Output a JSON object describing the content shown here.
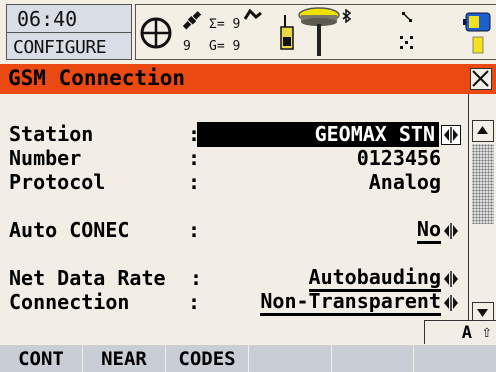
{
  "status": {
    "time": "06:40",
    "app_name": "CONFIGURE",
    "sat_sigma": "Σ= 9",
    "sat_g": "G= 9",
    "sat_count": "9"
  },
  "panel": {
    "title": "GSM Connection"
  },
  "fields": [
    {
      "label": "Station",
      "value": "GEOMAX STN"
    },
    {
      "label": "Number",
      "value": "0123456"
    },
    {
      "label": "Protocol",
      "value": "Analog"
    },
    {
      "label": "Auto CONEC",
      "value": "No"
    },
    {
      "label": "Net Data Rate",
      "value": "Autobauding"
    },
    {
      "label": "Connection",
      "value": "Non-Transparent"
    }
  ],
  "input_mode": {
    "mode": "A",
    "shift": "⇧"
  },
  "softkeys": {
    "f1": "CONT",
    "f2": "NEAR",
    "f3": "CODES",
    "f4": "",
    "f5": "",
    "f6": ""
  },
  "colors": {
    "title_bar": "#ea4a12",
    "softkey_bar": "#c9cdd5",
    "clock_box": "#d8dde6",
    "background": "#f2eee6"
  }
}
